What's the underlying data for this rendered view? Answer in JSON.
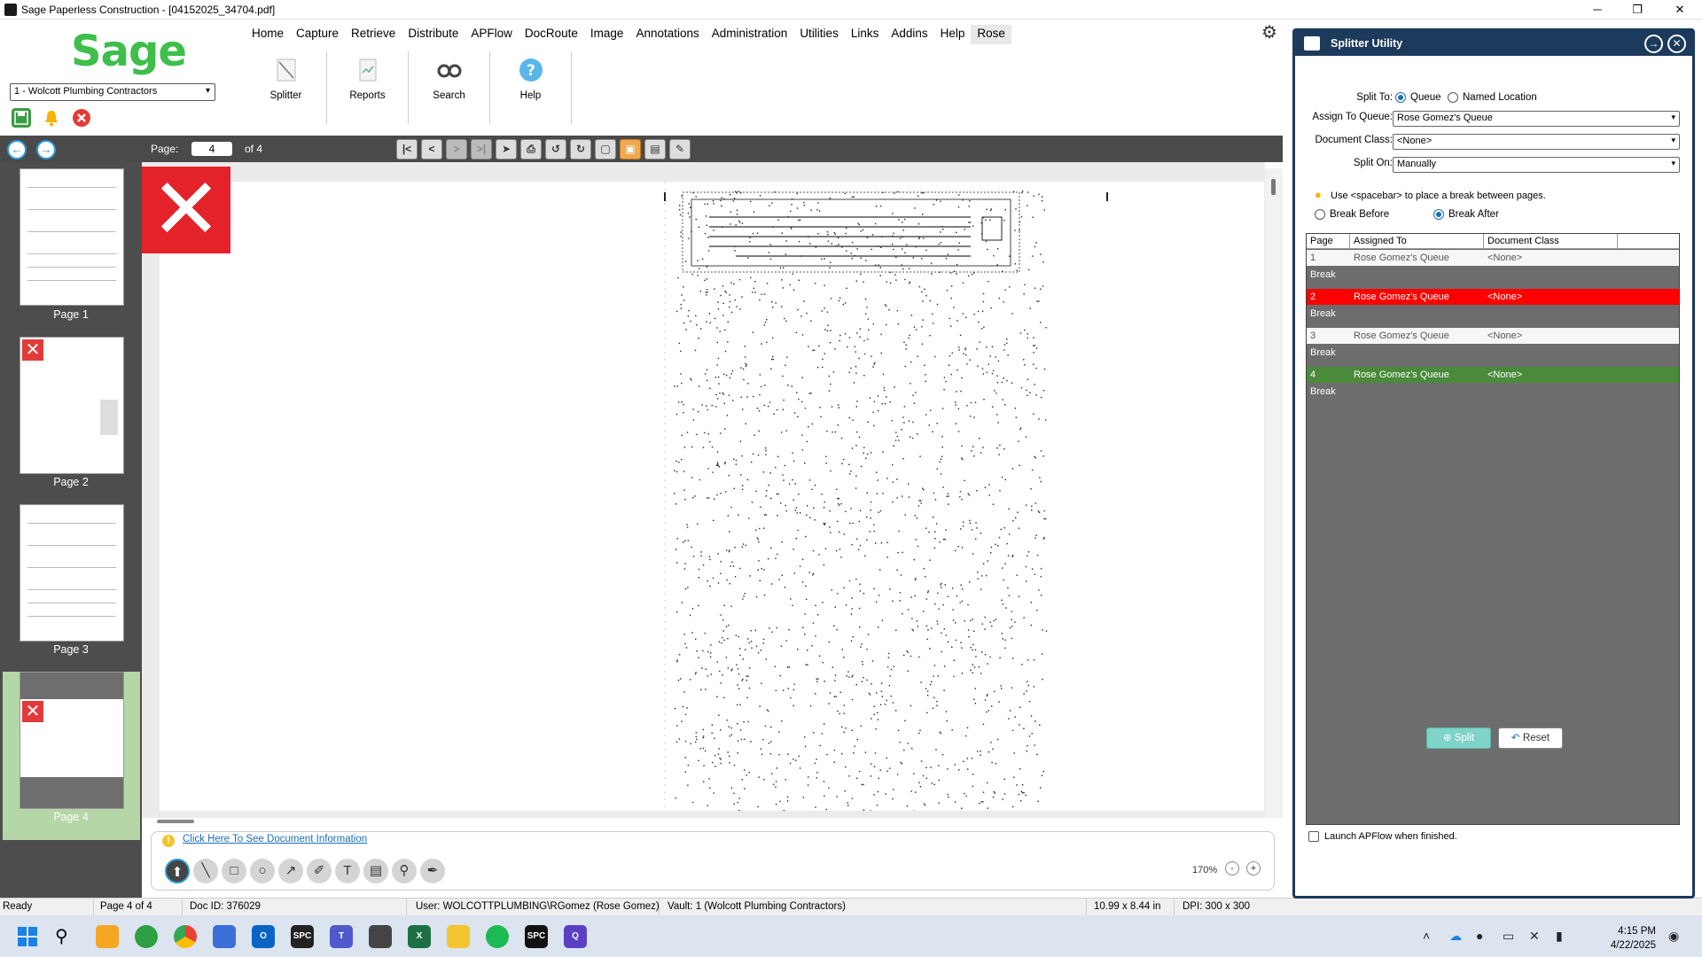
{
  "window": {
    "title": "Sage Paperless Construction - [04152025_34704.pdf]",
    "min": "─",
    "max": "❐",
    "close": "✕"
  },
  "logo": {
    "text": "Sage",
    "color": "#3dbf4a"
  },
  "company": {
    "selected": "1 - Wolcott Plumbing Contractors"
  },
  "menu": [
    "Home",
    "Capture",
    "Retrieve",
    "Distribute",
    "APFlow",
    "DocRoute",
    "Image",
    "Annotations",
    "Administration",
    "Utilities",
    "Links",
    "Addins",
    "Help",
    "Rose"
  ],
  "ribbon": [
    {
      "label": "Splitter",
      "icon": "splitter-icon"
    },
    {
      "label": "Reports",
      "icon": "reports-icon"
    },
    {
      "label": "Search",
      "icon": "binoculars-icon"
    },
    {
      "label": "Help",
      "icon": "help-icon"
    }
  ],
  "viewer": {
    "page_label": "Page:",
    "page_value": "4",
    "of_label": "of 4",
    "zoom": "170%"
  },
  "thumbnails": [
    {
      "label": "Page 1",
      "deleted": false
    },
    {
      "label": "Page 2",
      "deleted": true
    },
    {
      "label": "Page 3",
      "deleted": false
    },
    {
      "label": "Page 4",
      "deleted": true
    }
  ],
  "document_info_link": "Click Here To See Document Information",
  "status": {
    "state": "Ready",
    "page": "Page 4 of 4",
    "docid": "Doc ID: 376029",
    "user": "User: WOLCOTTPLUMBING\\RGomez (Rose Gomez)",
    "vault": "Vault: 1 (Wolcott Plumbing Contractors)",
    "size": "10.99 x 8.44 in",
    "dpi": "DPI: 300 x 300"
  },
  "splitter": {
    "title": "Splitter Utility",
    "split_to_label": "Split To:",
    "opt_queue": "Queue",
    "opt_named": "Named Location",
    "assign_label": "Assign To Queue:",
    "assign_value": "Rose Gomez's Queue",
    "docclass_label": "Document Class:",
    "docclass_value": "<None>",
    "spliton_label": "Split On:",
    "spliton_value": "Manually",
    "hint": "Use <spacebar> to place a break between pages.",
    "break_before": "Break Before",
    "break_after": "Break After",
    "col_page": "Page",
    "col_assigned": "Assigned To",
    "col_class": "Document Class",
    "rows": [
      {
        "page": "1",
        "assigned": "Rose Gomez's Queue",
        "class": "<None>",
        "break": "Break",
        "state": "normal"
      },
      {
        "page": "2",
        "assigned": "Rose Gomez's Queue",
        "class": "<None>",
        "break": "Break",
        "state": "deleted"
      },
      {
        "page": "3",
        "assigned": "Rose Gomez's Queue",
        "class": "<None>",
        "break": "Break",
        "state": "normal"
      },
      {
        "page": "4",
        "assigned": "Rose Gomez's Queue",
        "class": "<None>",
        "break": "Break",
        "state": "current"
      }
    ],
    "launch_label": "Launch APFlow when finished.",
    "split_btn": "Split",
    "reset_btn": "Reset"
  },
  "clock": {
    "time": "4:15 PM",
    "date": "4/22/2025"
  },
  "colors": {
    "accent": "#1b3a5c",
    "deleted": "#ff0000",
    "current": "#4a8a3a",
    "highlight": "#f0a94f"
  }
}
